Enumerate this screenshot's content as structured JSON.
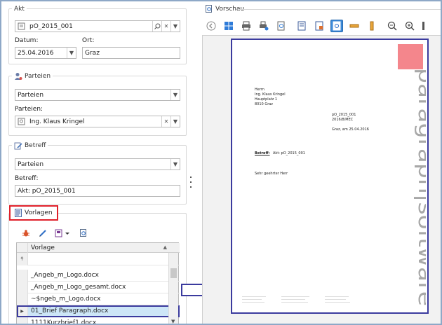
{
  "akt": {
    "title": "Akt",
    "aktnr_value": "pO_2015_001",
    "datum_label": "Datum:",
    "datum_value": "25.04.2016",
    "ort_label": "Ort:",
    "ort_value": "Graz"
  },
  "parteien": {
    "title": "Parteien",
    "dropdown_value": "Parteien",
    "field_label": "Parteien:",
    "field_value": "Ing. Klaus Kringel"
  },
  "betreff": {
    "title": "Betreff",
    "dropdown_value": "Parteien",
    "field_label": "Betreff:",
    "field_value": "Akt: pO_2015_001"
  },
  "vorlagen": {
    "title": "Vorlagen",
    "column_header": "Vorlage",
    "rows": [
      "_Angeb_m_Logo.docx",
      "_Angeb_m_Logo_gesamt.docx",
      "~$ngeb_m_Logo.docx",
      "01_Brief Paragraph.docx",
      "1111Kurzbrief1.docx"
    ]
  },
  "vorschau": {
    "title": "Vorschau",
    "document": {
      "addr1": "Herrn",
      "addr2": "Ing. Klaus Kringel",
      "addr3": "Hauptplatz 1",
      "addr4": "8010 Graz",
      "ref1": "pO_2015_001",
      "ref2": "2016/8/MEC",
      "date_line": "Graz, am 25.04.2016",
      "betreff_label": "Betreff:",
      "betreff_value": "Akt: pO_2015_001",
      "salutation": "Sehr geehrter Herr",
      "brand": "paragraph|software"
    }
  },
  "colors": {
    "highlight_red": "#e0202a",
    "highlight_blue": "#3b3b9e",
    "selected_row": "#cde6f7",
    "toolbar_active": "#3c8ad8",
    "logo_pink": "#f4868c"
  }
}
